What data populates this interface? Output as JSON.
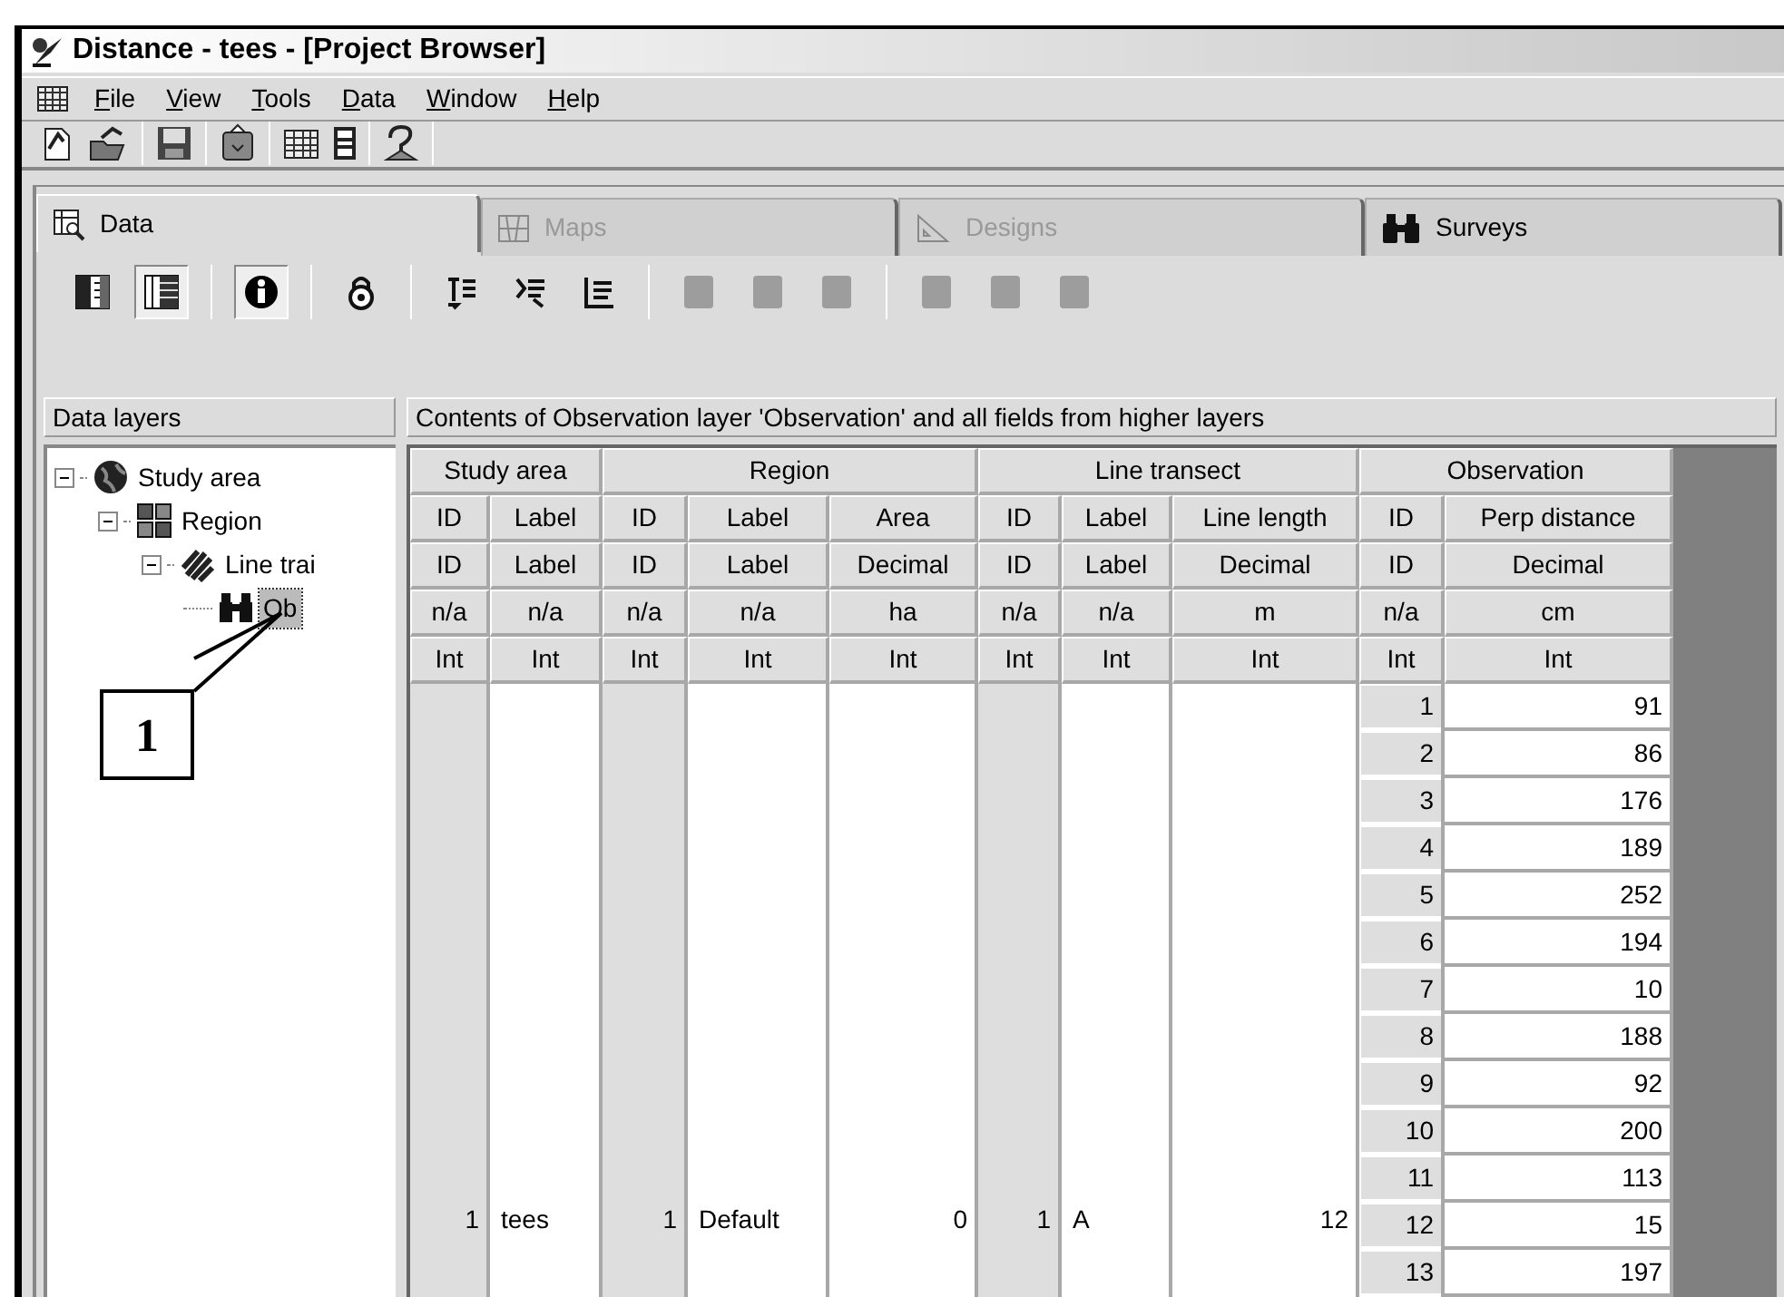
{
  "window": {
    "title": "Distance - tees - [Project Browser]"
  },
  "menu": [
    "File",
    "View",
    "Tools",
    "Data",
    "Window",
    "Help"
  ],
  "tabs": [
    {
      "label": "Data",
      "selected": true,
      "disabled": false
    },
    {
      "label": "Maps",
      "selected": false,
      "disabled": true
    },
    {
      "label": "Designs",
      "selected": false,
      "disabled": true
    },
    {
      "label": "Surveys",
      "selected": false,
      "disabled": false
    }
  ],
  "layer_toolbar": [
    {
      "kind": "grid-left",
      "pressed": false,
      "disabled": false
    },
    {
      "kind": "grid-right",
      "pressed": true,
      "disabled": false
    },
    {
      "kind": "info",
      "pressed": true,
      "disabled": false
    },
    {
      "kind": "lock",
      "pressed": false,
      "disabled": false
    },
    {
      "kind": "add-field",
      "pressed": false,
      "disabled": false
    },
    {
      "kind": "edit-field",
      "pressed": false,
      "disabled": false
    },
    {
      "kind": "delete-field",
      "pressed": false,
      "disabled": false
    },
    {
      "kind": "blank",
      "pressed": false,
      "disabled": true
    },
    {
      "kind": "blank",
      "pressed": false,
      "disabled": true
    },
    {
      "kind": "blank",
      "pressed": false,
      "disabled": true
    },
    {
      "kind": "blank",
      "pressed": false,
      "disabled": true
    },
    {
      "kind": "blank",
      "pressed": false,
      "disabled": true
    },
    {
      "kind": "blank",
      "pressed": false,
      "disabled": true
    }
  ],
  "data_layers": {
    "header": "Data layers",
    "tree": [
      {
        "label": "Study area",
        "kind": "globe",
        "expanded": true,
        "selected": false,
        "children": [
          {
            "label": "Region",
            "kind": "region",
            "expanded": true,
            "selected": false,
            "children": [
              {
                "label": "Line trai",
                "kind": "lines",
                "expanded": true,
                "selected": false,
                "children": [
                  {
                    "label": "Ob",
                    "kind": "binoculars",
                    "selected": true
                  }
                ]
              }
            ]
          }
        ]
      }
    ]
  },
  "contents": {
    "header": "Contents of Observation layer 'Observation' and all fields from higher layers",
    "groups": [
      {
        "label": "Study area",
        "columns": [
          {
            "name": "ID",
            "type": "ID",
            "units": "n/a",
            "datatype": "Int",
            "kind": "id",
            "value": "1"
          },
          {
            "name": "Label",
            "type": "Label",
            "units": "n/a",
            "datatype": "Int",
            "kind": "text",
            "value": "tees"
          }
        ]
      },
      {
        "label": "Region",
        "columns": [
          {
            "name": "ID",
            "type": "ID",
            "units": "n/a",
            "datatype": "Int",
            "kind": "id",
            "value": "1"
          },
          {
            "name": "Label",
            "type": "Label",
            "units": "n/a",
            "datatype": "Int",
            "kind": "text",
            "value": "Default"
          },
          {
            "name": "Area",
            "type": "Decimal",
            "units": "ha",
            "datatype": "Int",
            "kind": "number",
            "value": "0"
          }
        ]
      },
      {
        "label": "Line transect",
        "columns": [
          {
            "name": "ID",
            "type": "ID",
            "units": "n/a",
            "datatype": "Int",
            "kind": "id",
            "value": "1"
          },
          {
            "name": "Label",
            "type": "Label",
            "units": "n/a",
            "datatype": "Int",
            "kind": "text",
            "value": "A"
          },
          {
            "name": "Line length",
            "type": "Decimal",
            "units": "m",
            "datatype": "Int",
            "kind": "number",
            "value": "12"
          }
        ]
      },
      {
        "label": "Observation",
        "columns": [
          {
            "name": "ID",
            "type": "ID",
            "units": "n/a",
            "datatype": "Int",
            "kind": "id"
          },
          {
            "name": "Perp distance",
            "type": "Decimal",
            "units": "cm",
            "datatype": "Int",
            "kind": "number"
          }
        ]
      }
    ],
    "observations": [
      [
        "1",
        "91"
      ],
      [
        "2",
        "86"
      ],
      [
        "3",
        "176"
      ],
      [
        "4",
        "189"
      ],
      [
        "5",
        "252"
      ],
      [
        "6",
        "194"
      ],
      [
        "7",
        "10"
      ],
      [
        "8",
        "188"
      ],
      [
        "9",
        "92"
      ],
      [
        "10",
        "200"
      ],
      [
        "11",
        "113"
      ],
      [
        "12",
        "15"
      ],
      [
        "13",
        "197"
      ]
    ]
  },
  "callout": {
    "label": "1"
  }
}
